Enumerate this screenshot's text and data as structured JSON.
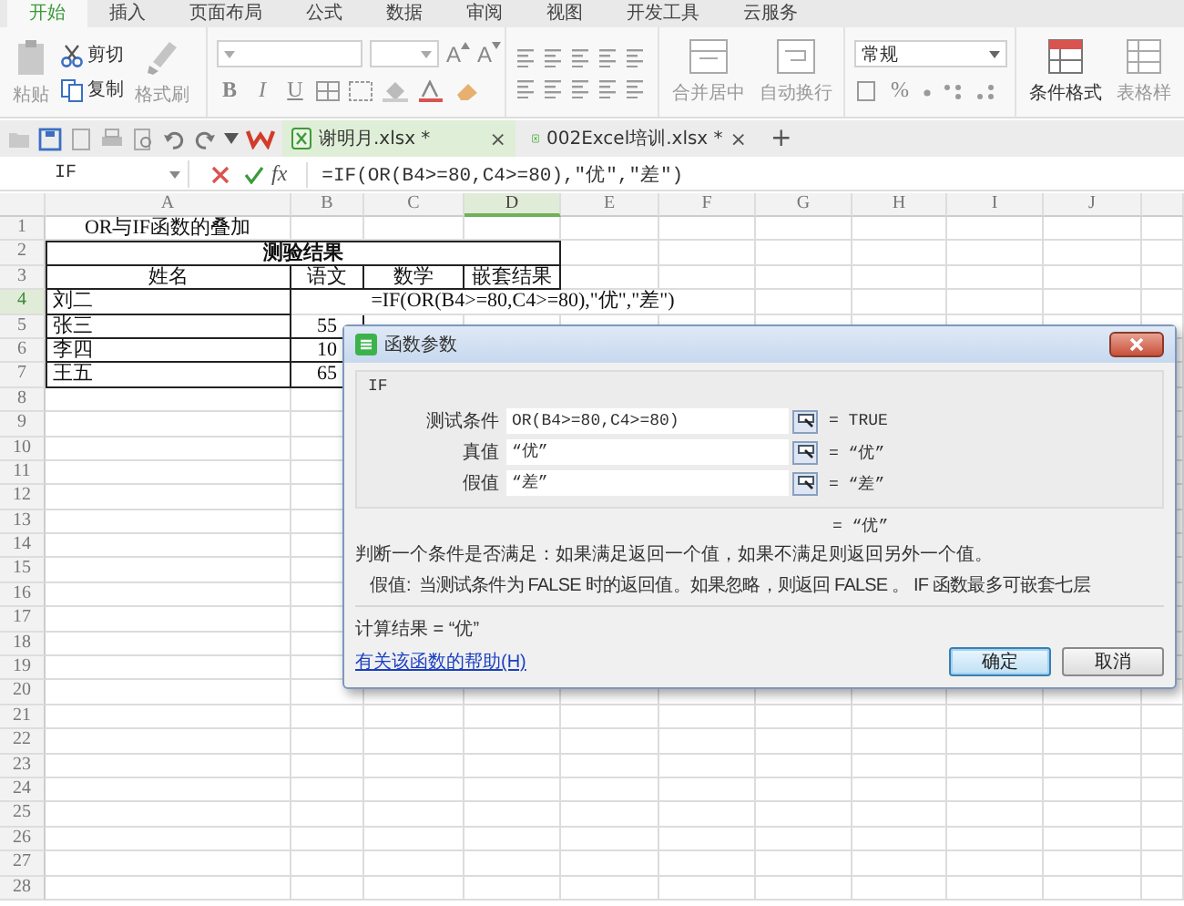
{
  "menu_tabs": [
    {
      "label": "开始",
      "selected": true
    },
    {
      "label": "插入",
      "selected": false
    },
    {
      "label": "页面布局",
      "selected": false
    },
    {
      "label": "公式",
      "selected": false
    },
    {
      "label": "数据",
      "selected": false
    },
    {
      "label": "审阅",
      "selected": false
    },
    {
      "label": "视图",
      "selected": false
    },
    {
      "label": "开发工具",
      "selected": false
    },
    {
      "label": "云服务",
      "selected": false
    }
  ],
  "ribbon": [
    {
      "kind": "clipboard",
      "paste": {
        "label": "粘贴",
        "disabled": true
      },
      "cut": {
        "label": "剪切",
        "disabled": false
      },
      "copy": {
        "label": "复制",
        "disabled": false
      },
      "painter": {
        "label": "格式刷",
        "disabled": true
      }
    },
    {
      "kind": "font",
      "bold": "B",
      "italic": "I",
      "underline": "U",
      "grow": "A",
      "shrink": "A"
    },
    {
      "kind": "align"
    },
    {
      "kind": "merge",
      "merge": {
        "label": "合并居中",
        "disabled": true
      },
      "wrap": {
        "label": "自动换行",
        "disabled": true
      }
    },
    {
      "kind": "number",
      "format": "常规",
      "percent": "%"
    },
    {
      "kind": "styles",
      "conditional": {
        "label": "条件格式",
        "disabled": false
      },
      "table": {
        "label": "表格样",
        "disabled": true
      }
    }
  ],
  "doc_tabs": [
    {
      "label": "谢明月.xlsx *",
      "close": "×",
      "selected": true
    },
    {
      "label": "002Excel培训.xlsx *",
      "close": "×",
      "selected": false
    }
  ],
  "new_tab": "+",
  "formula_bar": {
    "name_box": "IF",
    "fx": "fx",
    "formula": "=IF(OR(B4>=80,C4>=80),\"优\",\"差\")"
  },
  "columns": [
    {
      "label": "A",
      "selected": false
    },
    {
      "label": "B",
      "selected": false
    },
    {
      "label": "C",
      "selected": false
    },
    {
      "label": "D",
      "selected": true
    },
    {
      "label": "E",
      "selected": false
    },
    {
      "label": "F",
      "selected": false
    },
    {
      "label": "G",
      "selected": false
    },
    {
      "label": "H",
      "selected": false
    },
    {
      "label": "I",
      "selected": false
    },
    {
      "label": "J",
      "selected": false
    }
  ],
  "rows": [
    {
      "number": "1",
      "selected": false,
      "cells": {
        "A": {
          "kind": "caption",
          "text": "OR与IF函数的叠加"
        }
      }
    },
    {
      "number": "2",
      "selected": false,
      "cells": {
        "A:D": {
          "kind": "heading",
          "text": "测验结果"
        }
      }
    },
    {
      "number": "3",
      "selected": false,
      "cells": {
        "A": {
          "kind": "header",
          "text": "姓名"
        },
        "B": {
          "kind": "header",
          "text": "语文"
        },
        "C": {
          "kind": "header",
          "text": "数学"
        },
        "D": {
          "kind": "header",
          "text": "嵌套结果"
        }
      }
    },
    {
      "number": "4",
      "selected": true,
      "cells": {
        "A": {
          "kind": "text",
          "text": "刘二"
        },
        "B:F": {
          "kind": "formula",
          "text": "=IF(OR(B4>=80,C4>=80),\"优\",\"差\")"
        }
      }
    },
    {
      "number": "5",
      "selected": false,
      "cells": {
        "A": {
          "kind": "text",
          "text": "张三"
        },
        "B": {
          "kind": "number",
          "text": "55"
        }
      }
    },
    {
      "number": "6",
      "selected": false,
      "cells": {
        "A": {
          "kind": "text",
          "text": "李四"
        },
        "B": {
          "kind": "number",
          "text": "10"
        }
      }
    },
    {
      "number": "7",
      "selected": false,
      "cells": {
        "A": {
          "kind": "text",
          "text": "王五"
        },
        "B": {
          "kind": "number",
          "text": "65"
        }
      }
    },
    {
      "number": "8",
      "selected": false,
      "cells": {}
    },
    {
      "number": "9",
      "selected": false,
      "cells": {}
    },
    {
      "number": "10",
      "selected": false,
      "cells": {}
    },
    {
      "number": "11",
      "selected": false,
      "cells": {}
    },
    {
      "number": "12",
      "selected": false,
      "cells": {}
    },
    {
      "number": "13",
      "selected": false,
      "cells": {}
    },
    {
      "number": "14",
      "selected": false,
      "cells": {}
    },
    {
      "number": "15",
      "selected": false,
      "cells": {}
    },
    {
      "number": "16",
      "selected": false,
      "cells": {}
    },
    {
      "number": "17",
      "selected": false,
      "cells": {}
    },
    {
      "number": "18",
      "selected": false,
      "cells": {}
    },
    {
      "number": "19",
      "selected": false,
      "cells": {}
    },
    {
      "number": "20",
      "selected": false,
      "cells": {}
    },
    {
      "number": "21",
      "selected": false,
      "cells": {}
    },
    {
      "number": "22",
      "selected": false,
      "cells": {}
    },
    {
      "number": "23",
      "selected": false,
      "cells": {}
    },
    {
      "number": "24",
      "selected": false,
      "cells": {}
    },
    {
      "number": "25",
      "selected": false,
      "cells": {}
    },
    {
      "number": "26",
      "selected": false,
      "cells": {}
    },
    {
      "number": "27",
      "selected": false,
      "cells": {}
    },
    {
      "number": "28",
      "selected": false,
      "cells": {}
    }
  ],
  "dialog": {
    "title": "函数参数",
    "function": "IF",
    "arguments": [
      {
        "label": "测试条件",
        "value": "OR(B4>=80,C4>=80)",
        "result": "= TRUE"
      },
      {
        "label": "真值",
        "value": "“优”",
        "result": "= “优”"
      },
      {
        "label": "假值",
        "value": "“差”",
        "result": "= “差”"
      }
    ],
    "result": "= “优”",
    "description": "判断一个条件是否满足：如果满足返回一个值，如果不满足则返回另外一个值。",
    "argument_help": {
      "name": "假值:",
      "text": "当测试条件为 FALSE 时的返回值。如果忽略，则返回 FALSE 。 IF 函数最多可嵌套七层"
    },
    "calculation": "计算结果 = “优”",
    "help_link": "有关该函数的帮助(H)",
    "buttons": [
      {
        "label": "确定",
        "default": true
      },
      {
        "label": "取消",
        "default": false
      }
    ]
  }
}
